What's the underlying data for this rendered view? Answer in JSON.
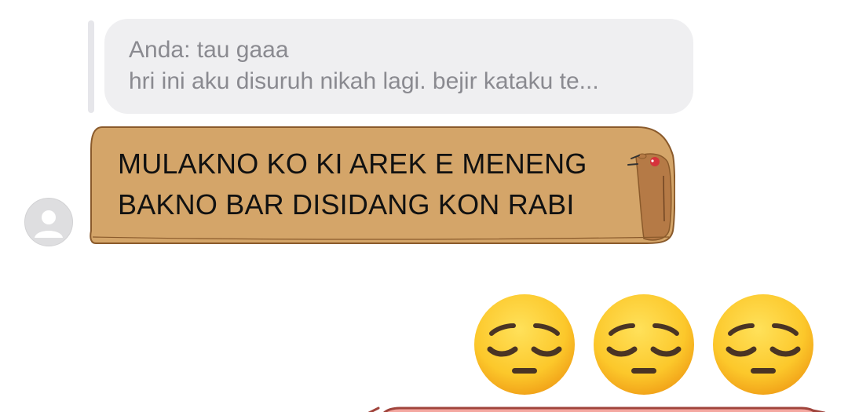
{
  "reply": {
    "sender_line": "Anda: tau gaaa",
    "preview_line": "hri ini aku disuruh nikah lagi. bejir kataku te..."
  },
  "message": {
    "line1": "MULAKNO KO KI AREK E MENENG",
    "line2": "BAKNO BAR DISIDANG KON RABI",
    "bubble_color": "#d4a569"
  },
  "reactions": {
    "emojis": [
      "pensive-face",
      "pensive-face",
      "pensive-face"
    ]
  },
  "colors": {
    "reply_bg": "#efeff1",
    "reply_text": "#8a8a90",
    "emoji_yellow": "#fbc52c",
    "next_bubble": "#f4a7a0"
  }
}
